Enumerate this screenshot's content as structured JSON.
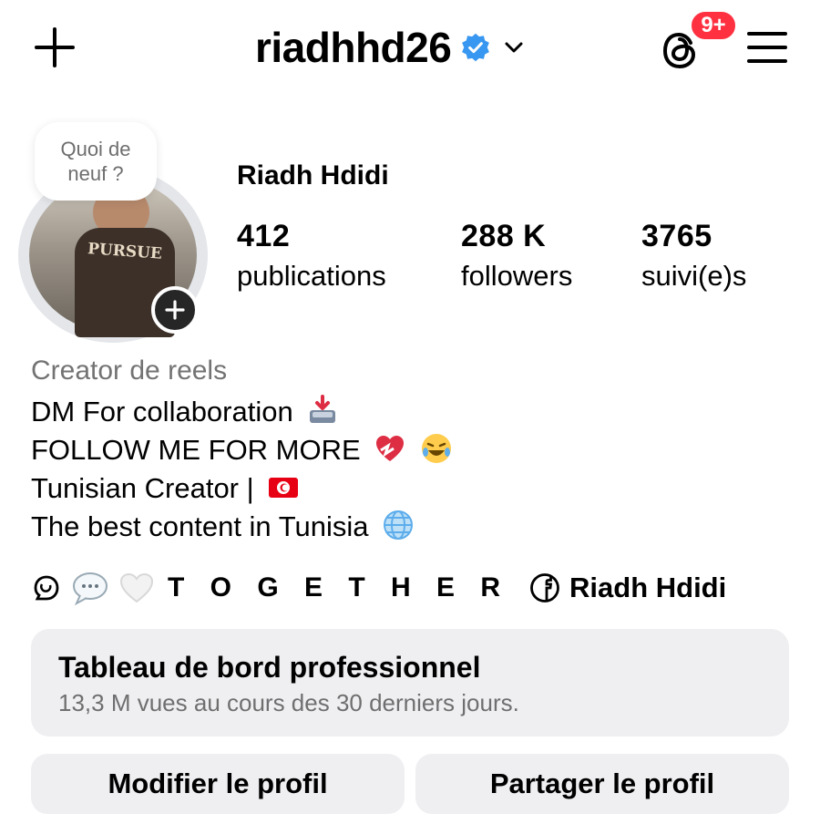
{
  "header": {
    "username": "riadhhd26",
    "notification_badge": "9+",
    "icons": [
      "plus-icon",
      "verified-badge-icon",
      "chevron-down-icon",
      "threads-icon",
      "menu-icon"
    ]
  },
  "profile": {
    "note": [
      "Quoi de",
      "neuf ?"
    ],
    "full_name": "Riadh Hdidi",
    "avatar_shirt_text": "PURSUE",
    "stats": [
      {
        "value": "412",
        "label": "publications"
      },
      {
        "value": "288 K",
        "label": "followers"
      },
      {
        "value": "3765",
        "label": "suivi(e)s"
      }
    ]
  },
  "bio": {
    "category": "Creator de reels",
    "lines": [
      "DM For collaboration",
      "FOLLOW ME FOR MORE",
      "Tunisian Creator |",
      "The best content in Tunisia"
    ],
    "emojis": [
      "inbox-tray-emoji",
      "heart-emoji",
      "laughing-emoji",
      "tunisia-flag-emoji",
      "globe-emoji"
    ],
    "links_row": {
      "together": "T O G E T H E R",
      "facebook_name": "Riadh Hdidi"
    }
  },
  "dashboard": {
    "title": "Tableau de bord professionnel",
    "subtitle": "13,3 M vues au cours des 30 derniers jours."
  },
  "actions": {
    "edit_label": "Modifier le profil",
    "share_label": "Partager le profil"
  },
  "colors": {
    "verified": "#3897f0",
    "badge": "#ff3040",
    "muted_text": "#737373",
    "card_bg": "#efeff2"
  }
}
